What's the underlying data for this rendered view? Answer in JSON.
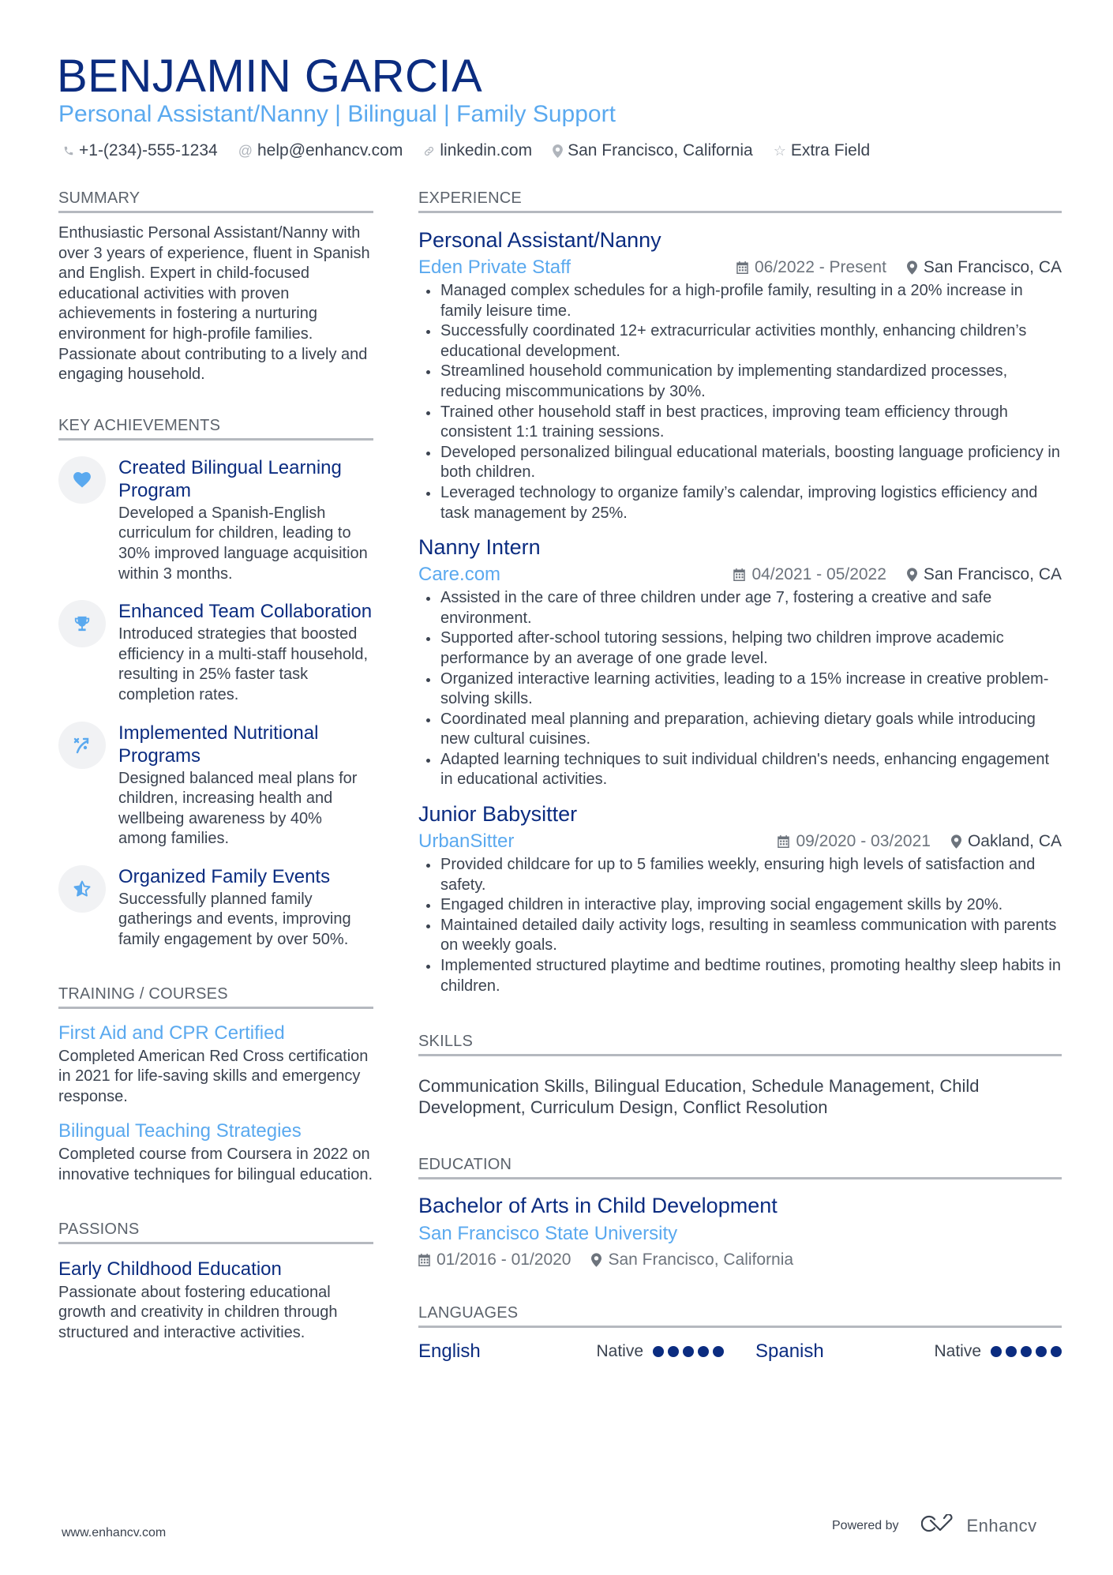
{
  "header": {
    "name": "BENJAMIN GARCIA",
    "tagline": "Personal Assistant/Nanny | Bilingual | Family Support",
    "contacts": [
      {
        "icon": "phone-icon",
        "text": "+1-(234)-555-1234"
      },
      {
        "icon": "at-icon",
        "text": "help@enhancv.com"
      },
      {
        "icon": "link-icon",
        "text": "linkedin.com"
      },
      {
        "icon": "location-icon",
        "text": "San Francisco, California"
      },
      {
        "icon": "star-icon",
        "text": "Extra Field"
      }
    ]
  },
  "summary": {
    "title": "SUMMARY",
    "text": "Enthusiastic Personal Assistant/Nanny with over 3 years of experience, fluent in Spanish and English. Expert in child-focused educational activities with proven achievements in fostering a nurturing environment for high-profile families. Passionate about contributing to a lively and engaging household."
  },
  "achievements": {
    "title": "KEY ACHIEVEMENTS",
    "items": [
      {
        "icon": "heart-icon",
        "title": "Created Bilingual Learning Program",
        "desc": "Developed a Spanish-English curriculum for children, leading to 30% improved language acquisition within 3 months."
      },
      {
        "icon": "trophy-icon",
        "title": "Enhanced Team Collaboration",
        "desc": "Introduced strategies that boosted efficiency in a multi-staff household, resulting in 25% faster task completion rates."
      },
      {
        "icon": "strategy-icon",
        "title": "Implemented Nutritional Programs",
        "desc": "Designed balanced meal plans for children, increasing health and wellbeing awareness by 40% among families."
      },
      {
        "icon": "star-half-icon",
        "title": "Organized Family Events",
        "desc": "Successfully planned family gatherings and events, improving family engagement by over 50%."
      }
    ]
  },
  "training": {
    "title": "TRAINING / COURSES",
    "items": [
      {
        "title": "First Aid and CPR Certified",
        "desc": "Completed American Red Cross certification in 2021 for life-saving skills and emergency response."
      },
      {
        "title": "Bilingual Teaching Strategies",
        "desc": "Completed course from Coursera in 2022 on innovative techniques for bilingual education."
      }
    ]
  },
  "passions": {
    "title": "PASSIONS",
    "items": [
      {
        "title": "Early Childhood Education",
        "desc": "Passionate about fostering educational growth and creativity in children through structured and interactive activities."
      }
    ]
  },
  "experience": {
    "title": "EXPERIENCE",
    "jobs": [
      {
        "title": "Personal Assistant/Nanny",
        "company": "Eden Private Staff",
        "dates": "06/2022 - Present",
        "location": "San Francisco, CA",
        "bullets": [
          "Managed complex schedules for a high-profile family, resulting in a 20% increase in family leisure time.",
          "Successfully coordinated 12+ extracurricular activities monthly, enhancing children’s educational development.",
          "Streamlined household communication by implementing standardized processes, reducing miscommunications by 30%.",
          "Trained other household staff in best practices, improving team efficiency through consistent 1:1 training sessions.",
          "Developed personalized bilingual educational materials, boosting language proficiency in both children.",
          "Leveraged technology to organize family’s calendar, improving logistics efficiency and task management by 25%."
        ]
      },
      {
        "title": "Nanny Intern",
        "company": "Care.com",
        "dates": "04/2021 - 05/2022",
        "location": "San Francisco, CA",
        "bullets": [
          "Assisted in the care of three children under age 7, fostering a creative and safe environment.",
          "Supported after-school tutoring sessions, helping two children improve academic performance by an average of one grade level.",
          "Organized interactive learning activities, leading to a 15% increase in creative problem-solving skills.",
          "Coordinated meal planning and preparation, achieving dietary goals while introducing new cultural cuisines.",
          "Adapted learning techniques to suit individual children's needs, enhancing engagement in educational activities."
        ]
      },
      {
        "title": "Junior Babysitter",
        "company": "UrbanSitter",
        "dates": "09/2020 - 03/2021",
        "location": "Oakland, CA",
        "bullets": [
          "Provided childcare for up to 5 families weekly, ensuring high levels of satisfaction and safety.",
          "Engaged children in interactive play, improving social engagement skills by 20%.",
          "Maintained detailed daily activity logs, resulting in seamless communication with parents on weekly goals.",
          "Implemented structured playtime and bedtime routines, promoting healthy sleep habits in children."
        ]
      }
    ]
  },
  "skills": {
    "title": "SKILLS",
    "text": "Communication Skills, Bilingual Education, Schedule Management, Child Development, Curriculum Design, Conflict Resolution"
  },
  "education": {
    "title": "EDUCATION",
    "items": [
      {
        "degree": "Bachelor of Arts in Child Development",
        "school": "San Francisco State University",
        "dates": "01/2016 - 01/2020",
        "location": "San Francisco, California"
      }
    ]
  },
  "languages": {
    "title": "LANGUAGES",
    "items": [
      {
        "name": "English",
        "level": "Native",
        "rating": 5,
        "max": 5
      },
      {
        "name": "Spanish",
        "level": "Native",
        "rating": 5,
        "max": 5
      }
    ]
  },
  "footer": {
    "website": "www.enhancv.com",
    "powered_by": "Powered by",
    "brand": "Enhancv"
  },
  "colors": {
    "primary": "#0b2c80",
    "accent": "#5aa9ef",
    "text": "#3b4350",
    "rule": "#b5b9bf"
  }
}
